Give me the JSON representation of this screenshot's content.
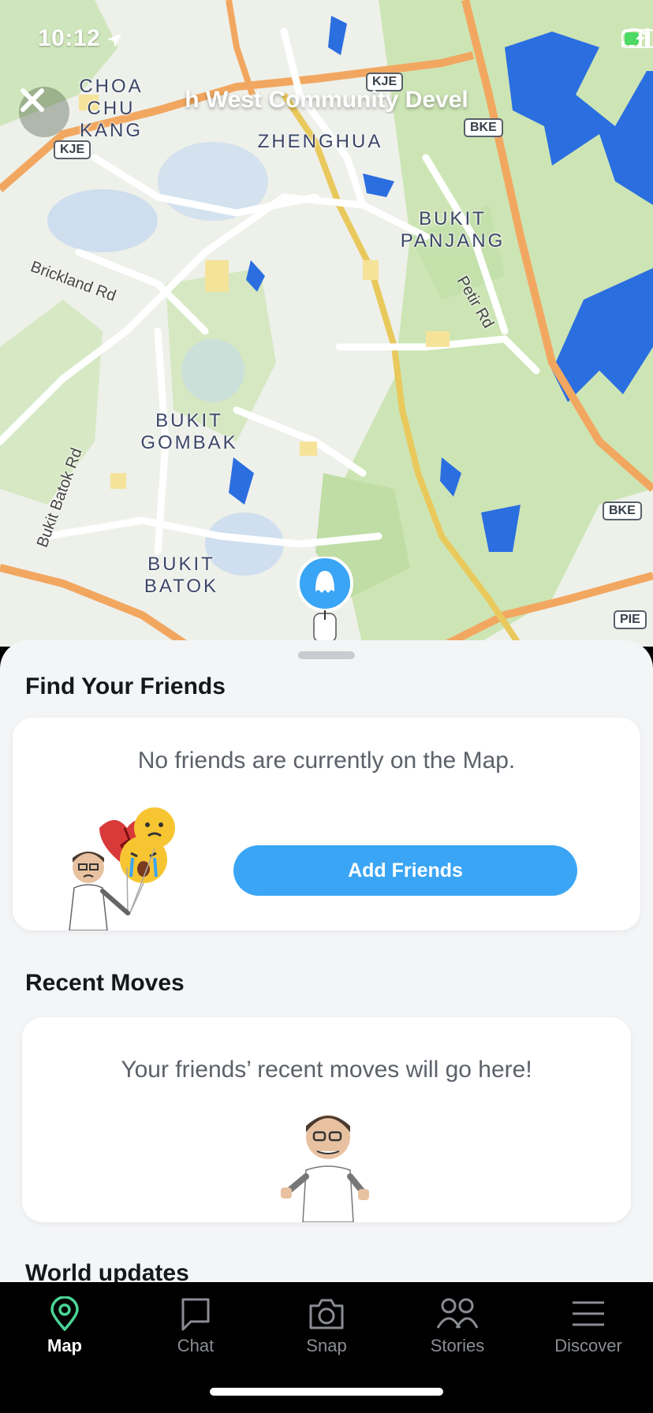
{
  "status_bar": {
    "time": "10:12"
  },
  "map": {
    "header_title": "h West Community Devel",
    "header_sub": "ZHENGHUA",
    "places": [
      {
        "id": "choa-chu-kang",
        "text": "CHOA CHU\nKANG"
      },
      {
        "id": "zhenghua",
        "text": "ZHENGHUA"
      },
      {
        "id": "bukit-panjang",
        "text": "BUKIT\nPANJANG"
      },
      {
        "id": "bukit-gombak",
        "text": "BUKIT\nGOMBAK"
      },
      {
        "id": "bukit-batok",
        "text": "BUKIT\nBATOK"
      }
    ],
    "roads": {
      "brickland": "Brickland Rd",
      "petir": "Petir Rd",
      "bukit_batok": "Bukit Batok Rd"
    },
    "shields": {
      "kje_top": "KJE",
      "kje_left": "KJE",
      "bke_top": "BKE",
      "bke_mid": "BKE",
      "pie": "PIE"
    }
  },
  "find_friends": {
    "title": "Find Your Friends",
    "message": "No friends are currently on the Map.",
    "button_label": "Add Friends"
  },
  "recent_moves": {
    "title": "Recent Moves",
    "message": "Your friends’ recent moves will go here!"
  },
  "world_updates": {
    "title": "World updates"
  },
  "tabs": [
    {
      "label": "Map",
      "icon": "map-pin-icon",
      "active": true
    },
    {
      "label": "Chat",
      "icon": "chat-icon",
      "active": false
    },
    {
      "label": "Snap",
      "icon": "camera-icon",
      "active": false
    },
    {
      "label": "Stories",
      "icon": "friends-icon",
      "active": false
    },
    {
      "label": "Discover",
      "icon": "menu-icon",
      "active": false
    }
  ],
  "colors": {
    "accent": "#3aa5f5",
    "map_green": "#cfe6b8",
    "water": "#2a6fe0",
    "expressway": "#f1a35e",
    "major_road": "#e9c75a"
  }
}
